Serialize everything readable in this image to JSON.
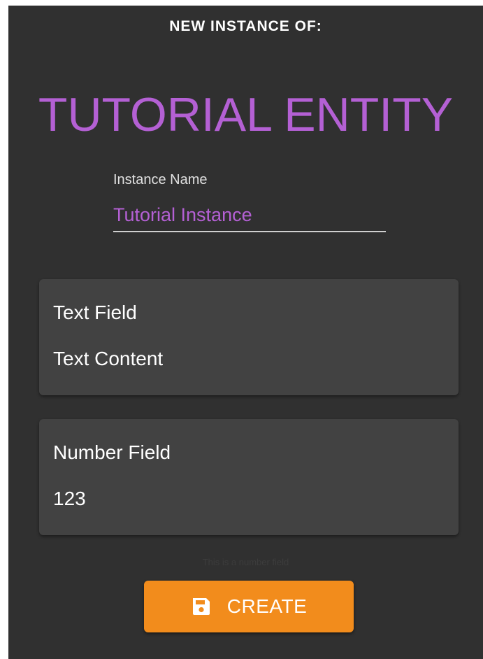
{
  "header": {
    "subtitle": "NEW INSTANCE OF:",
    "entity_name": "TUTORIAL ENTITY"
  },
  "instance_name": {
    "label": "Instance Name",
    "value": "Tutorial Instance"
  },
  "fields": [
    {
      "label": "Text Field",
      "value": "Text Content"
    },
    {
      "label": "Number Field",
      "value": "123"
    }
  ],
  "hint": "This is a number field",
  "actions": {
    "create_label": "CREATE",
    "create_icon": "save-icon"
  },
  "colors": {
    "accent": "#b460d4",
    "button": "#f28c1c",
    "panel": "#303030",
    "card": "#424242"
  }
}
